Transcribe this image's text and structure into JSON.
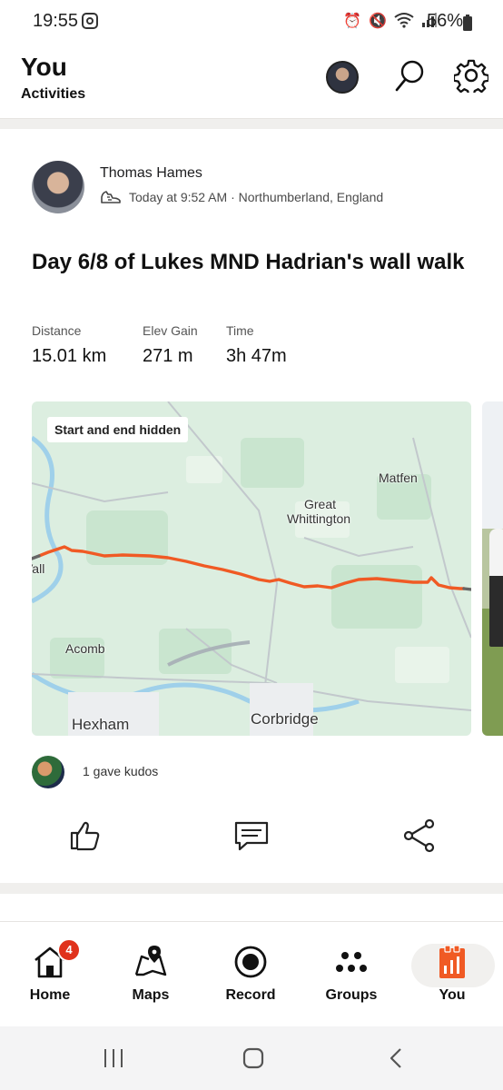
{
  "status_bar": {
    "time": "19:55",
    "battery": "56%"
  },
  "header": {
    "title": "You",
    "subtitle": "Activities"
  },
  "activity": {
    "athlete": "Thomas Hames",
    "meta": "Today at 9:52 AM · Northumberland, England",
    "title": "Day 6/8 of Lukes MND Hadrian's wall walk",
    "stats": [
      {
        "label": "Distance",
        "value": "15.01 km"
      },
      {
        "label": "Elev Gain",
        "value": "271 m"
      },
      {
        "label": "Time",
        "value": "3h 47m"
      }
    ],
    "map": {
      "badge": "Start and end hidden",
      "places": {
        "matfen": "Matfen",
        "great": "Great",
        "whittington": "Whittington",
        "wall": "Vall",
        "acomb": "Acomb",
        "hexham": "Hexham",
        "corbridge": "Corbridge"
      },
      "route_color": "#f05a24"
    },
    "kudos_text": "1 gave kudos"
  },
  "bottom_nav": {
    "items": [
      {
        "label": "Home",
        "badge": "4"
      },
      {
        "label": "Maps"
      },
      {
        "label": "Record"
      },
      {
        "label": "Groups"
      },
      {
        "label": "You",
        "active": true
      }
    ],
    "accent": "#f05a24"
  }
}
